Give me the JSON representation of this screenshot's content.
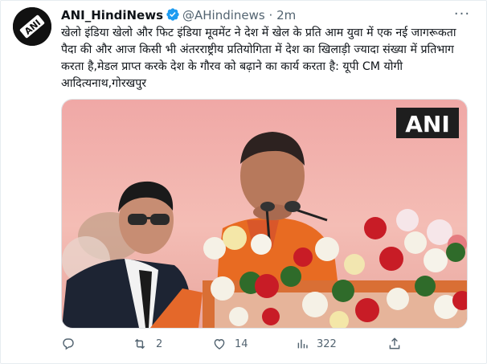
{
  "tweet": {
    "author_name": "ANI_HindiNews",
    "handle": "@AHindinews",
    "separator": "·",
    "time": "2m",
    "text": "खेलो इंडिया खेलो और फिट इंडिया मूवमेंट ने देश में खेल के प्रति आम युवा में एक नई जागरूकता पैदा की और आज किसी भी अंतरराष्ट्रीय प्रतियोगिता में देश का खिलाड़ी ज्यादा संख्या में प्रतिभाग करता है,मेडल प्राप्त करके देश के गौरव को बढ़ाने का कार्य करता है: यूपी CM योगी आदित्यनाथ,गोरखपुर",
    "more_label": "···",
    "watermark": "ANI",
    "avatar_logo": "ANI"
  },
  "actions": {
    "replies": "",
    "retweets": "2",
    "likes": "14",
    "views": "322"
  },
  "icons": {
    "verified": "verified-badge-icon",
    "reply": "reply-icon",
    "retweet": "retweet-icon",
    "like": "heart-icon",
    "views": "analytics-icon",
    "share": "share-icon",
    "more": "more-icon"
  },
  "colors": {
    "verified": "#1d9bf0",
    "muted": "#536471",
    "text": "#0f1419"
  }
}
